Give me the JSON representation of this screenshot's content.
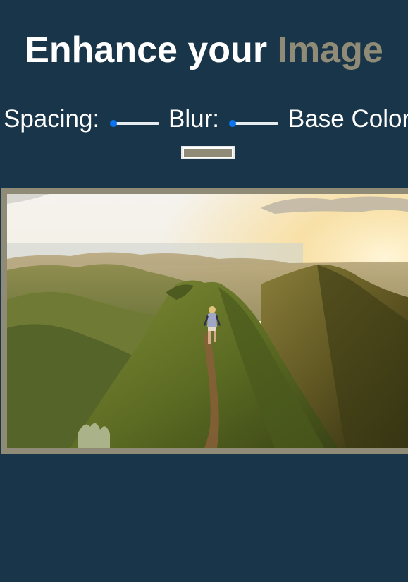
{
  "header": {
    "title_main": "Enhance your ",
    "title_highlight": "Image"
  },
  "controls": {
    "spacing_label": "Spacing:",
    "blur_label": "Blur:",
    "base_color_label": "Base Color:",
    "spacing_value": 0,
    "blur_value": 0,
    "base_color": "#8f8b77"
  },
  "image": {
    "icon": "mountain-hiker-photo"
  },
  "colors": {
    "background": "#193549",
    "accent": "#8f8b77",
    "slider_thumb": "#0a74ee",
    "slider_track": "#e7ecf0"
  }
}
